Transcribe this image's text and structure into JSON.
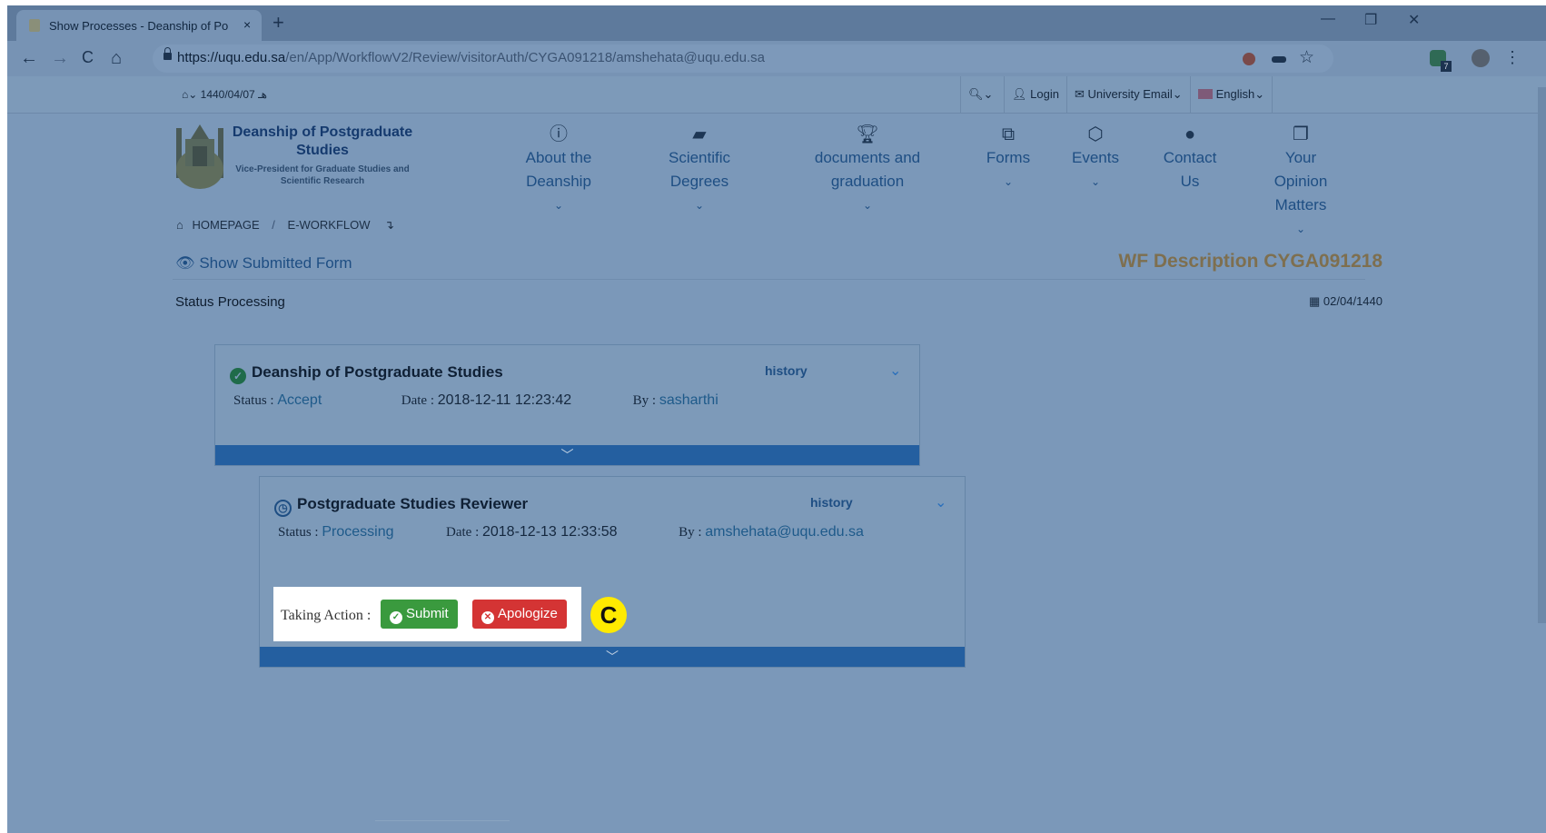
{
  "browser": {
    "tab_title": "Show Processes - Deanship of Po",
    "tab_close": "×",
    "new_tab": "+",
    "url_host": "https://uqu.edu.sa",
    "url_path": "/en/App/WorkflowV2/Review/visitorAuth/CYGA091218/amshehata@uqu.edu.sa",
    "controls": {
      "minimize": "—",
      "restore": "❐",
      "close": "✕"
    },
    "nav": {
      "back": "←",
      "forward": "→",
      "reload": "C",
      "home": "⌂"
    },
    "extension_badge": "7"
  },
  "topbar": {
    "date": "1440/04/07",
    "date_suffix": "هـ",
    "login": "Login",
    "university_email": "University Email",
    "language": "English"
  },
  "header": {
    "org_name": "Deanship of Postgraduate Studies",
    "org_sub": "Vice-President for Graduate Studies and Scientific Research",
    "nav": [
      {
        "label_1": "About the",
        "label_2": "Deanship",
        "icon": "info-icon"
      },
      {
        "label_1": "Scientific",
        "label_2": "Degrees",
        "icon": "book-icon"
      },
      {
        "label_1": "documents and",
        "label_2": "graduation",
        "icon": "trophy-icon"
      },
      {
        "label_1": "Forms",
        "icon": "copy-icon"
      },
      {
        "label_1": "Events",
        "icon": "hexagon-icon"
      },
      {
        "label_1": "Contact",
        "label_2": "Us",
        "icon": "android-icon"
      },
      {
        "label_1": "Your",
        "label_2": "Opinion",
        "label_3": "Matters",
        "icon": "clipboard-icon"
      }
    ]
  },
  "breadcrumb": {
    "home": "HOMEPAGE",
    "sep": "/",
    "current": "E-WORKFLOW",
    "arrow": "↴"
  },
  "page": {
    "show_form": "Show Submitted Form",
    "wf_title": "WF Description CYGA091218",
    "status_heading": "Status Processing",
    "date": "02/04/1440"
  },
  "cards": [
    {
      "title": "Deanship of Postgraduate Studies",
      "history": "history",
      "status_label": "Status :",
      "status_value": "Accept",
      "date_label": "Date :",
      "date_value": "2018-12-11 12:23:42",
      "by_label": "By :",
      "by_value": "sasharthi"
    },
    {
      "title": "Postgraduate Studies Reviewer",
      "history": "history",
      "status_label": "Status :",
      "status_value": "Processing",
      "date_label": "Date :",
      "date_value": "2018-12-13 12:33:58",
      "by_label": "By :",
      "by_value": "amshehata@uqu.edu.sa"
    }
  ],
  "action": {
    "label": "Taking Action :",
    "submit": "Submit",
    "apologize": "Apologize",
    "marker": "C"
  },
  "colors": {
    "overlay_bg": "#7b98b9",
    "brand_blue": "#245fa0",
    "submit_green": "#3a9a3e",
    "apologize_red": "#d43434",
    "marker_yellow": "#ffea00"
  }
}
